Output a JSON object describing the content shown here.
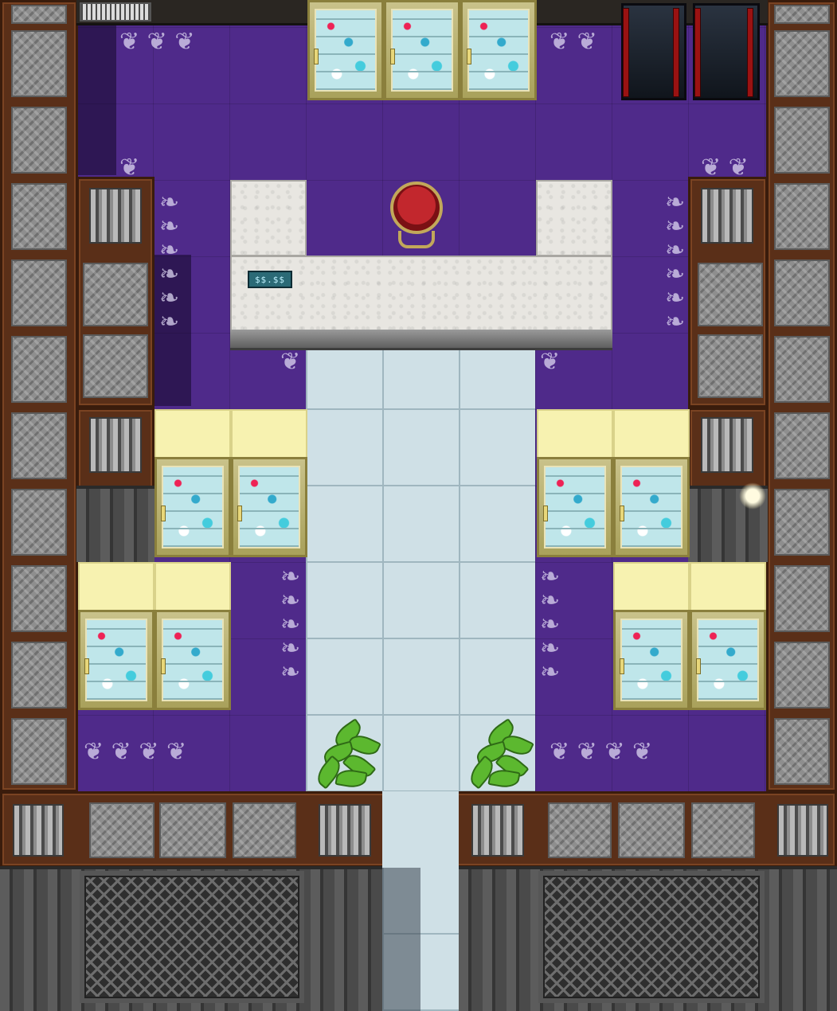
{
  "scene": {
    "type": "store-interior",
    "view": "top-down",
    "palette": {
      "carpet": "#4f2a8a",
      "wall_trim": "#5a2f18",
      "tile_floor": "#cfe0e6",
      "marble": "#e8e6e1",
      "cooler_frame": "#c9c28a",
      "chair_red": "#c2272d"
    },
    "objects": {
      "cash_register": {
        "icon": "cash-register-icon"
      },
      "throne_chair": {
        "icon": "red-throne-chair-icon"
      },
      "potted_plants": 2,
      "drink_coolers": 11,
      "exit_doors": 2
    }
  }
}
